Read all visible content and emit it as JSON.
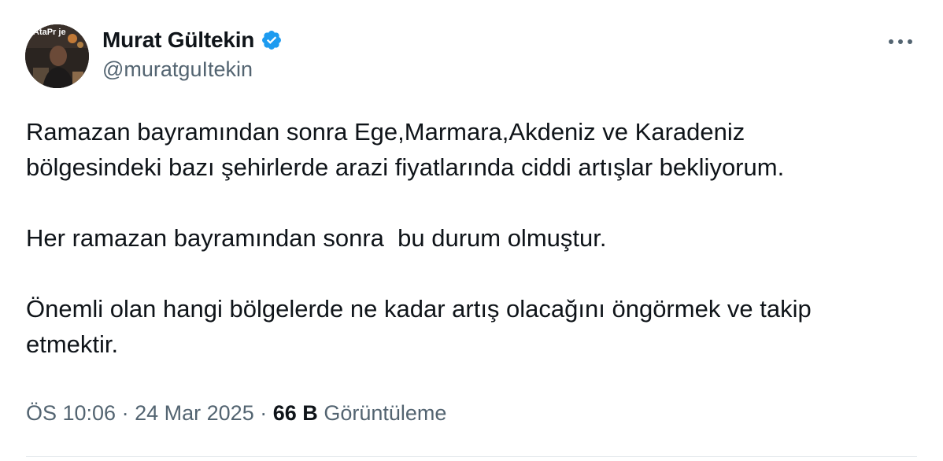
{
  "author": {
    "display_name": "Murat Gültekin",
    "handle": "@muratguItekin",
    "verified": true,
    "avatar_text": "AtaPr je"
  },
  "tweet": {
    "paragraphs": [
      "Ramazan bayramından sonra Ege,Marmara,Akdeniz ve Karadeniz\nbölgesindeki bazı şehirlerde arazi fiyatlarında ciddi artışlar bekliyorum.",
      "Her ramazan bayramından sonra  bu durum olmuştur.",
      "Önemli olan hangi bölgelerde ne kadar artış olacağını öngörmek ve takip\netmektir."
    ]
  },
  "meta": {
    "time": "ÖS 10:06",
    "separator": "·",
    "date": "24 Mar 2025",
    "views_count": "66 B",
    "views_label": "Görüntüleme"
  },
  "colors": {
    "text": "#0f1419",
    "secondary": "#536471",
    "verified": "#1d9bf0"
  },
  "icons": {
    "verified": "verified-badge-icon",
    "more": "more-horizontal-icon"
  }
}
